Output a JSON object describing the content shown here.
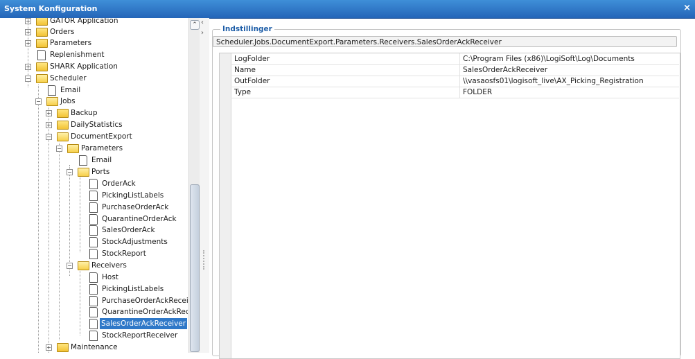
{
  "window": {
    "title": "System Konfiguration",
    "close_glyph": "×"
  },
  "tree": {
    "items": [
      {
        "label": "GATOR Application"
      },
      {
        "label": "Orders"
      },
      {
        "label": "Parameters"
      },
      {
        "label": "Replenishment"
      },
      {
        "label": "SHARK Application"
      },
      {
        "label": "Scheduler"
      },
      {
        "label": "Email"
      },
      {
        "label": "Jobs"
      },
      {
        "label": "Backup"
      },
      {
        "label": "DailyStatistics"
      },
      {
        "label": "DocumentExport"
      },
      {
        "label": "Parameters"
      },
      {
        "label": "Email"
      },
      {
        "label": "Ports"
      },
      {
        "label": "OrderAck"
      },
      {
        "label": "PickingListLabels"
      },
      {
        "label": "PurchaseOrderAck"
      },
      {
        "label": "QuarantineOrderAck"
      },
      {
        "label": "SalesOrderAck"
      },
      {
        "label": "StockAdjustments"
      },
      {
        "label": "StockReport"
      },
      {
        "label": "Receivers"
      },
      {
        "label": "Host"
      },
      {
        "label": "PickingListLabels"
      },
      {
        "label": "PurchaseOrderAckReceiv"
      },
      {
        "label": "QuarantineOrderAckRece"
      },
      {
        "label": "SalesOrderAckReceiver"
      },
      {
        "label": "StockReportReceiver"
      },
      {
        "label": "Maintenance"
      }
    ]
  },
  "settings": {
    "group_title": "Indstillinger",
    "path": "Scheduler.Jobs.DocumentExport.Parameters.Receivers.SalesOrderAckReceiver",
    "rows": [
      {
        "key": "LogFolder",
        "value": "C:\\Program Files (x86)\\LogiSoft\\Log\\Documents"
      },
      {
        "key": "Name",
        "value": "SalesOrderAckReceiver"
      },
      {
        "key": "OutFolder",
        "value": "\\\\vasaosfs01\\logisoft_live\\AX_Picking_Registration"
      },
      {
        "key": "Type",
        "value": "FOLDER"
      }
    ]
  },
  "icons": {
    "expand": "+",
    "collapse": "−",
    "scroll_up": "⌃",
    "collapse_left": "‹",
    "expand_right": "›"
  },
  "colors": {
    "titlebar": "#2f78c8",
    "selection": "#2f78c8",
    "group_title": "#1e5ea8"
  }
}
